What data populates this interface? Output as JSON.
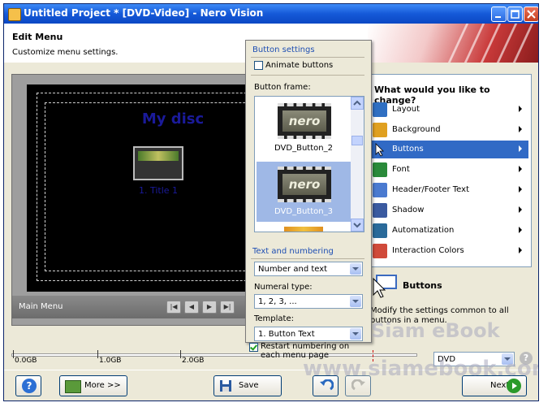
{
  "window": {
    "title": "Untitled Project * [DVD-Video] - Nero Vision"
  },
  "header": {
    "title": "Edit Menu",
    "subtitle": "Customize menu settings."
  },
  "preview": {
    "disc_title": "My disc",
    "thumb_caption": "1. Title 1",
    "menu_label": "Main Menu"
  },
  "right_panel": {
    "question": "What would you like to change?",
    "items": [
      {
        "label": "Layout",
        "icon": "layout-icon",
        "color": "#2f6fc2"
      },
      {
        "label": "Background",
        "icon": "background-icon",
        "color": "#e0a020"
      },
      {
        "label": "Buttons",
        "icon": "cursor-icon",
        "color": "#ffffff"
      },
      {
        "label": "Font",
        "icon": "font-icon",
        "color": "#2a8a3a"
      },
      {
        "label": "Header/Footer Text",
        "icon": "header-footer-icon",
        "color": "#4a7ad0"
      },
      {
        "label": "Shadow",
        "icon": "shadow-icon",
        "color": "#3a5aa0"
      },
      {
        "label": "Automatization",
        "icon": "automatization-icon",
        "color": "#2a6a9a"
      },
      {
        "label": "Interaction Colors",
        "icon": "interaction-colors-icon",
        "color": "#d04a3a"
      }
    ],
    "selected_index": 2
  },
  "buttons_info": {
    "title": "Buttons",
    "description": "Modify the settings common to all buttons in a menu."
  },
  "popup": {
    "section_button_settings": "Button settings",
    "animate_buttons_label": "Animate buttons",
    "animate_buttons_checked": false,
    "button_frame_label": "Button frame:",
    "frames": [
      {
        "caption": "DVD_Button_2",
        "logo": "nero"
      },
      {
        "caption": "DVD_Button_3",
        "logo": "nero"
      }
    ],
    "section_text_numbering": "Text and numbering",
    "text_mode_value": "Number and text",
    "numeral_type_label": "Numeral type:",
    "numeral_type_value": "1, 2, 3, ...",
    "template_label": "Template:",
    "template_value": "1. Button Text",
    "restart_numbering_label": "Restart numbering on each menu page",
    "restart_numbering_checked": true
  },
  "capacity": {
    "labels": [
      "0.0GB",
      "1.0GB",
      "2.0GB"
    ],
    "disc_type": "DVD"
  },
  "bottom": {
    "more_label": "More >>",
    "save_label": "Save",
    "next_label": "Next"
  },
  "watermark": {
    "line1": "Siam eBook",
    "line2": "www.siamebook.com"
  },
  "colors": {
    "titlebar": "#1559d8",
    "selection": "#316ac5",
    "disc_title_text": "#1a1a9a"
  }
}
